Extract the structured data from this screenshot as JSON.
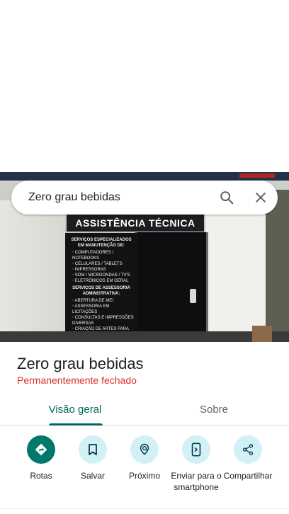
{
  "search": {
    "query": "Zero grau bebidas",
    "search_icon": "search-icon",
    "close_icon": "close-icon"
  },
  "photo": {
    "sign_text": "ASSISTÊNCIA TÉCNICA",
    "poster": {
      "heading1": "SERVIÇOS ESPECIALIZADOS EM MANUTENÇÃO DE:",
      "items1": [
        "COMPUTADORES / NOTEBOOKS",
        "CELULARES / TABLETS",
        "IMPRESSORAS",
        "SOM / MICROONDAS / TV'S",
        "ELETRÔNICOS EM GERAL"
      ],
      "heading2": "SERVIÇOS DE ASSESSORIA ADMINISTRATIVA:",
      "items2": [
        "ABERTURA DE MEI",
        "ASSESSORIA EM LICITAÇÕES",
        "CONSULTAS E IMPRESSÕES DIVERSAS",
        "CRIAÇÃO DE ARTES PARA PUBLICIDADE"
      ]
    }
  },
  "place": {
    "name": "Zero grau bebidas",
    "status": "Permanentemente fechado",
    "status_color": "#d93025"
  },
  "tabs": [
    {
      "label": "Visão geral",
      "active": true
    },
    {
      "label": "Sobre",
      "active": false
    }
  ],
  "actions": [
    {
      "label": "Rotas",
      "icon": "directions-icon"
    },
    {
      "label": "Salvar",
      "icon": "bookmark-icon"
    },
    {
      "label": "Próximo",
      "icon": "nearby-icon"
    },
    {
      "label": "Enviar para o smartphone",
      "icon": "send-to-phone-icon"
    },
    {
      "label": "Compartilhar",
      "icon": "share-icon"
    }
  ],
  "colors": {
    "accent": "#00695c",
    "primary_button": "#00796b",
    "secondary_button": "#d2f1f7"
  }
}
